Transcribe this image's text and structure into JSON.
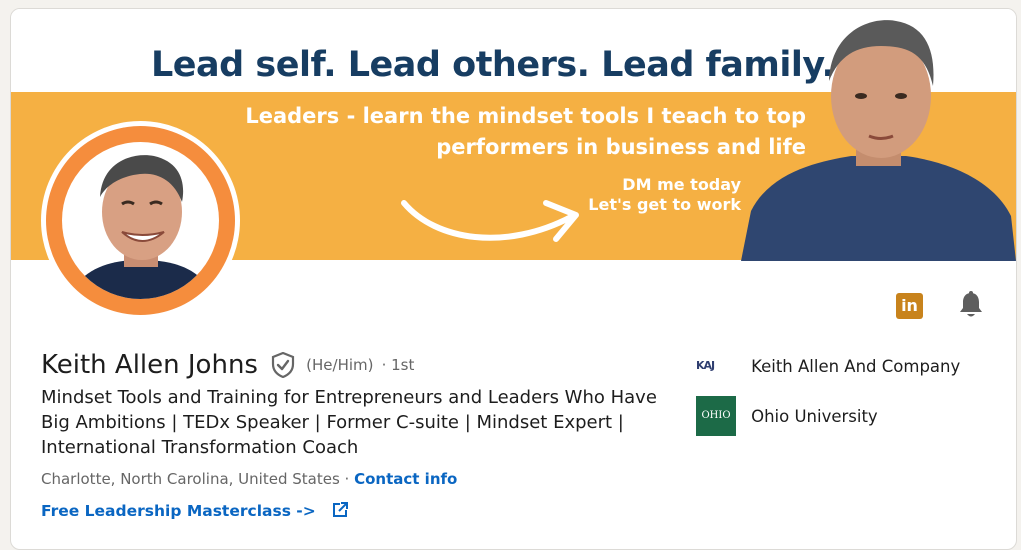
{
  "banner": {
    "headline": "Lead self. Lead others. Lead family.",
    "tagline": "Leaders - learn the mindset tools I teach to top performers in business and life",
    "cta_line1": "DM me today",
    "cta_line2": "Let's get to work"
  },
  "profile": {
    "name": "Keith Allen Johns",
    "pronouns": "(He/Him)",
    "degree": "· 1st",
    "headline": "Mindset Tools and Training for Entrepreneurs and Leaders Who Have Big Ambitions | TEDx Speaker | Former C-suite | Mindset Expert | International Transformation Coach",
    "location": "Charlotte, North Carolina, United States",
    "separator": "·",
    "contact_info_label": "Contact info",
    "website_label": "Free Leadership Masterclass ->"
  },
  "actions": {
    "linkedin_icon": "linkedin-icon",
    "bell_icon": "bell-icon",
    "linkedin_text": "in"
  },
  "organizations": [
    {
      "name": "Keith Allen And Company",
      "logo_text": "KAJ"
    },
    {
      "name": "Ohio University",
      "logo_text": "OHIO"
    }
  ],
  "colors": {
    "banner_orange": "#f5b043",
    "headline_navy": "#173d62",
    "avatar_ring": "#f58d3d",
    "link_blue": "#0a66c2",
    "linkedin_gold": "#c8831c",
    "ohio_green": "#1c6a47"
  }
}
